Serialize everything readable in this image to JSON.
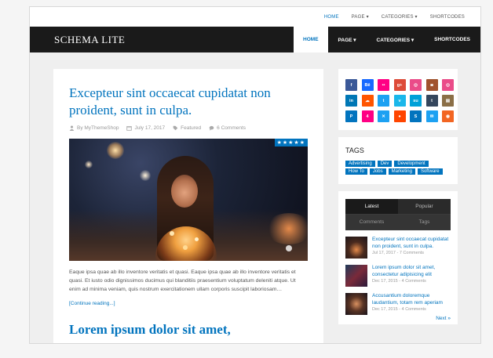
{
  "topnav": {
    "items": [
      "HOME",
      "PAGE ▾",
      "CATEGORIES ▾",
      "SHORTCODES"
    ]
  },
  "brand": "SCHEMA LITE",
  "mainnav": {
    "items": [
      "HOME",
      "PAGE ▾",
      "CATEGORIES ▾",
      "SHORTCODES"
    ]
  },
  "post": {
    "title": "Excepteur sint occaecat cupidatat non proident, sunt in culpa.",
    "author": "By MyThemeShop",
    "date": "July 17, 2017",
    "category": "Featured",
    "comments": "6 Comments",
    "stars": "★★★★★",
    "excerpt": "Eaque ipsa quae ab illo inventore veritatis et quasi. Eaque ipsa quae ab illo inventore veritatis et quasi. Et iusto odio dignissimos ducimus qui blanditiis praesentium voluptatum deleniti atque. Ut enim ad minima veniam, quis nostrum exercitationem ullam corporis suscipit laboriosam…",
    "more": "[Continue reading...]"
  },
  "post2": {
    "title": "Lorem ipsum dolor sit amet,"
  },
  "social": [
    {
      "icon": "facebook-icon",
      "glyph": "f",
      "color": "#3b5998"
    },
    {
      "icon": "behance-icon",
      "glyph": "Bē",
      "color": "#1769ff"
    },
    {
      "icon": "flickr-icon",
      "glyph": "••",
      "color": "#ff0084"
    },
    {
      "icon": "google-plus-icon",
      "glyph": "g+",
      "color": "#dd4b39"
    },
    {
      "icon": "dribbble-icon",
      "glyph": "◎",
      "color": "#ea4c89"
    },
    {
      "icon": "instagram-icon",
      "glyph": "◙",
      "color": "#a0522d"
    },
    {
      "icon": "dribbble-alt-icon",
      "glyph": "◎",
      "color": "#ea4c89"
    },
    {
      "icon": "linkedin-icon",
      "glyph": "in",
      "color": "#0077b5"
    },
    {
      "icon": "soundcloud-icon",
      "glyph": "☁",
      "color": "#ff5500"
    },
    {
      "icon": "twitter-icon",
      "glyph": "t",
      "color": "#1da1f2"
    },
    {
      "icon": "vimeo-icon",
      "glyph": "v",
      "color": "#1ab7ea"
    },
    {
      "icon": "stumbleupon-icon",
      "glyph": "su",
      "color": "#00a1d8"
    },
    {
      "icon": "tumblr-icon",
      "glyph": "t",
      "color": "#35465c"
    },
    {
      "icon": "rss-icon",
      "glyph": "▤",
      "color": "#8b6f47"
    },
    {
      "icon": "pinterest-icon",
      "glyph": "P",
      "color": "#0274be"
    },
    {
      "icon": "foursquare-icon",
      "glyph": "4",
      "color": "#ff0084"
    },
    {
      "icon": "xing-icon",
      "glyph": "✕",
      "color": "#1da1f2"
    },
    {
      "icon": "reddit-icon",
      "glyph": "●",
      "color": "#ff4500"
    },
    {
      "icon": "skype-icon",
      "glyph": "S",
      "color": "#0274be"
    },
    {
      "icon": "email-icon",
      "glyph": "✉",
      "color": "#1da1f2"
    },
    {
      "icon": "rss-feed-icon",
      "glyph": "◉",
      "color": "#f26522"
    }
  ],
  "tags": {
    "title": "TAGS",
    "items": [
      "Advertising",
      "Dev",
      "Development",
      "How To",
      "Jobs",
      "Marketing",
      "Software"
    ]
  },
  "tabs": {
    "latest": "Latest",
    "popular": "Popular",
    "comments": "Comments",
    "tags": "Tags"
  },
  "recent": [
    {
      "title": "Excepteur sint occaecat cupidatat non proident, sunt in culpa.",
      "meta": "Jul 17, 2017 - 7 Comments"
    },
    {
      "title": "Lorem ipsum dolor sit amet, consectetur adipisicing elit",
      "meta": "Dec 17, 2015 - 4 Comments"
    },
    {
      "title": "Accusantium doloremque laudantium, totam rem aperiam",
      "meta": "Dec 17, 2015 - 4 Comments"
    }
  ],
  "next": "Next »"
}
